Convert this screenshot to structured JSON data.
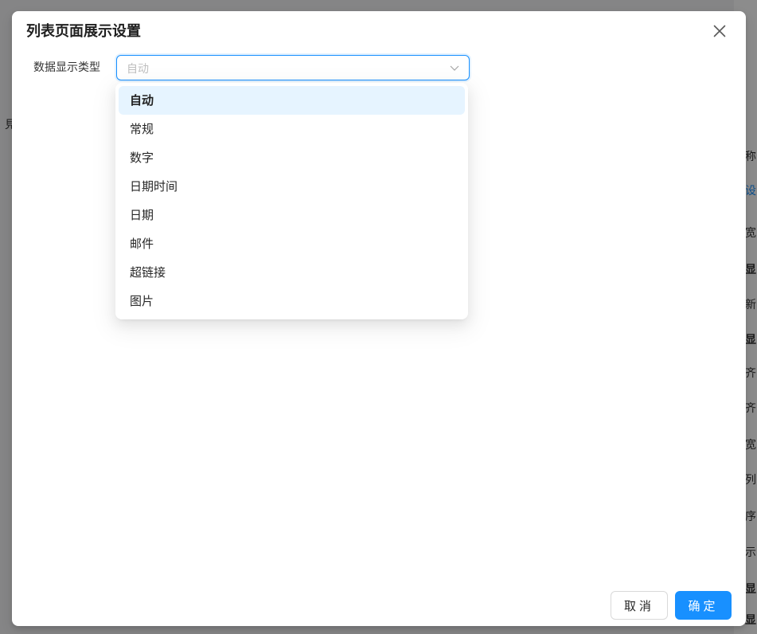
{
  "background": {
    "left_fragment": "見",
    "right_fragments": [
      "称",
      "设",
      "宽",
      "显",
      "新",
      "显",
      "齐",
      "齐",
      "宽",
      "列",
      "序",
      "示",
      "显",
      "显"
    ]
  },
  "modal": {
    "title": "列表页面展示设置",
    "close_icon": "close-icon"
  },
  "form": {
    "field_label": "数据显示类型",
    "select": {
      "placeholder": "自动",
      "arrow_icon": "chevron-down-icon",
      "options": [
        {
          "label": "自动",
          "selected": true
        },
        {
          "label": "常规",
          "selected": false
        },
        {
          "label": "数字",
          "selected": false
        },
        {
          "label": "日期时间",
          "selected": false
        },
        {
          "label": "日期",
          "selected": false
        },
        {
          "label": "邮件",
          "selected": false
        },
        {
          "label": "超链接",
          "selected": false
        },
        {
          "label": "图片",
          "selected": false
        }
      ]
    }
  },
  "footer": {
    "cancel_label": "取消",
    "ok_label": "确定"
  },
  "colors": {
    "primary": "#1890ff",
    "selected_option_bg": "#e6f4ff",
    "mask": "rgba(0,0,0,0.45)"
  }
}
